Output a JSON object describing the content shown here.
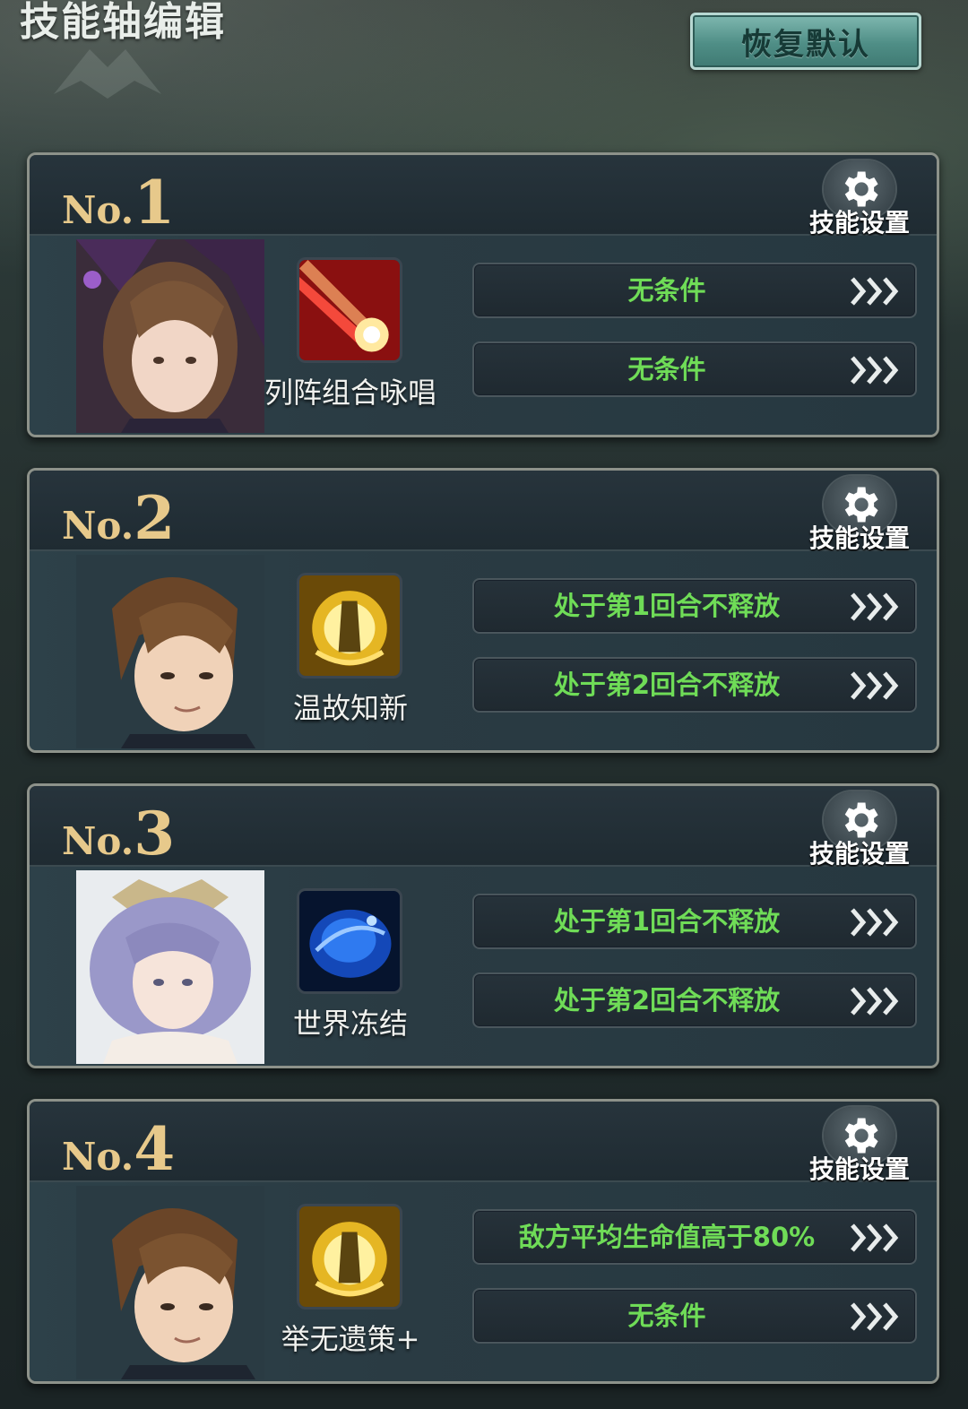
{
  "header": {
    "title": "技能轴编辑",
    "reset_label": "恢复默认"
  },
  "cards": [
    {
      "no_prefix": "No.",
      "no": "1",
      "settings_label": "技能设置",
      "skill_name": "列阵组合咏唱",
      "skill_icon": "red-laser-skill-icon",
      "conditions": [
        "无条件",
        "无条件"
      ]
    },
    {
      "no_prefix": "No.",
      "no": "2",
      "settings_label": "技能设置",
      "skill_name": "温故知新",
      "skill_icon": "golden-aura-skill-icon",
      "conditions": [
        "处于第1回合不释放",
        "处于第2回合不释放"
      ]
    },
    {
      "no_prefix": "No.",
      "no": "3",
      "settings_label": "技能设置",
      "skill_name": "世界冻结",
      "skill_icon": "blue-ice-skill-icon",
      "conditions": [
        "处于第1回合不释放",
        "处于第2回合不释放"
      ]
    },
    {
      "no_prefix": "No.",
      "no": "4",
      "settings_label": "技能设置",
      "skill_name": "举无遗策+",
      "skill_icon": "golden-aura-skill-icon",
      "conditions": [
        "敌方平均生命值高于80%",
        "无条件"
      ]
    }
  ],
  "colors": {
    "condition_text": "#6fdc57",
    "number_gold": "#e7c98b",
    "reset_button": "#4f8e86"
  }
}
